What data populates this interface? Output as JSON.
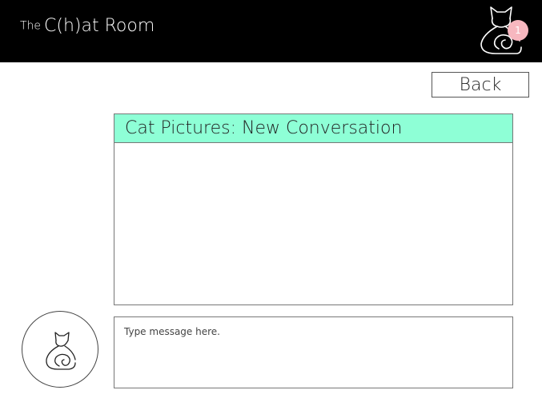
{
  "header": {
    "title_prefix": "The",
    "title_main": "C(h)at Room",
    "notification_count": "1"
  },
  "nav": {
    "back_label": "Back"
  },
  "conversation": {
    "title": "Cat Pictures: New Conversation",
    "header_color": "#8effd6",
    "messages": []
  },
  "composer": {
    "placeholder": "Type message here."
  },
  "icons": {
    "profile": "cat-icon",
    "avatar": "cat-icon"
  }
}
